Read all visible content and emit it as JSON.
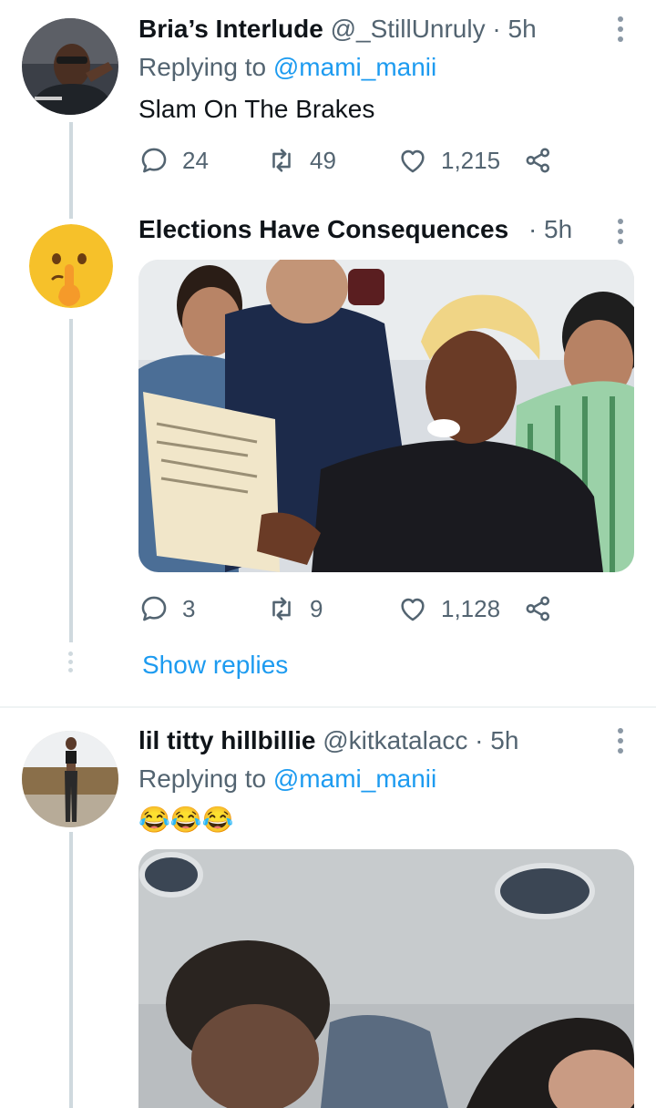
{
  "tweets": [
    {
      "display_name": "Bria’s Interlude",
      "handle": "@_StillUnruly",
      "time": "· 5h",
      "replying_prefix": "Replying to",
      "replying_to": "@mami_manii",
      "text": "Slam On The Brakes",
      "replies": "24",
      "retweets": "49",
      "likes": "1,215"
    },
    {
      "display_name": "Elections Have Consequences",
      "time": "· 5h",
      "replies": "3",
      "retweets": "9",
      "likes": "1,128",
      "show_replies": "Show replies"
    },
    {
      "display_name": "lil titty hillbillie",
      "handle": "@kitkatalacc",
      "time": "· 5h",
      "replying_prefix": "Replying to",
      "replying_to": "@mami_manii",
      "text": "😂😂😂"
    }
  ],
  "icons": {
    "reply": "speech-bubble",
    "retweet": "retweet-arrows",
    "like": "heart",
    "share": "share-nodes",
    "more": "vertical-ellipsis"
  },
  "colors": {
    "accent": "#1d9bf0",
    "muted": "#536471",
    "thread_line": "#cfd9de"
  }
}
